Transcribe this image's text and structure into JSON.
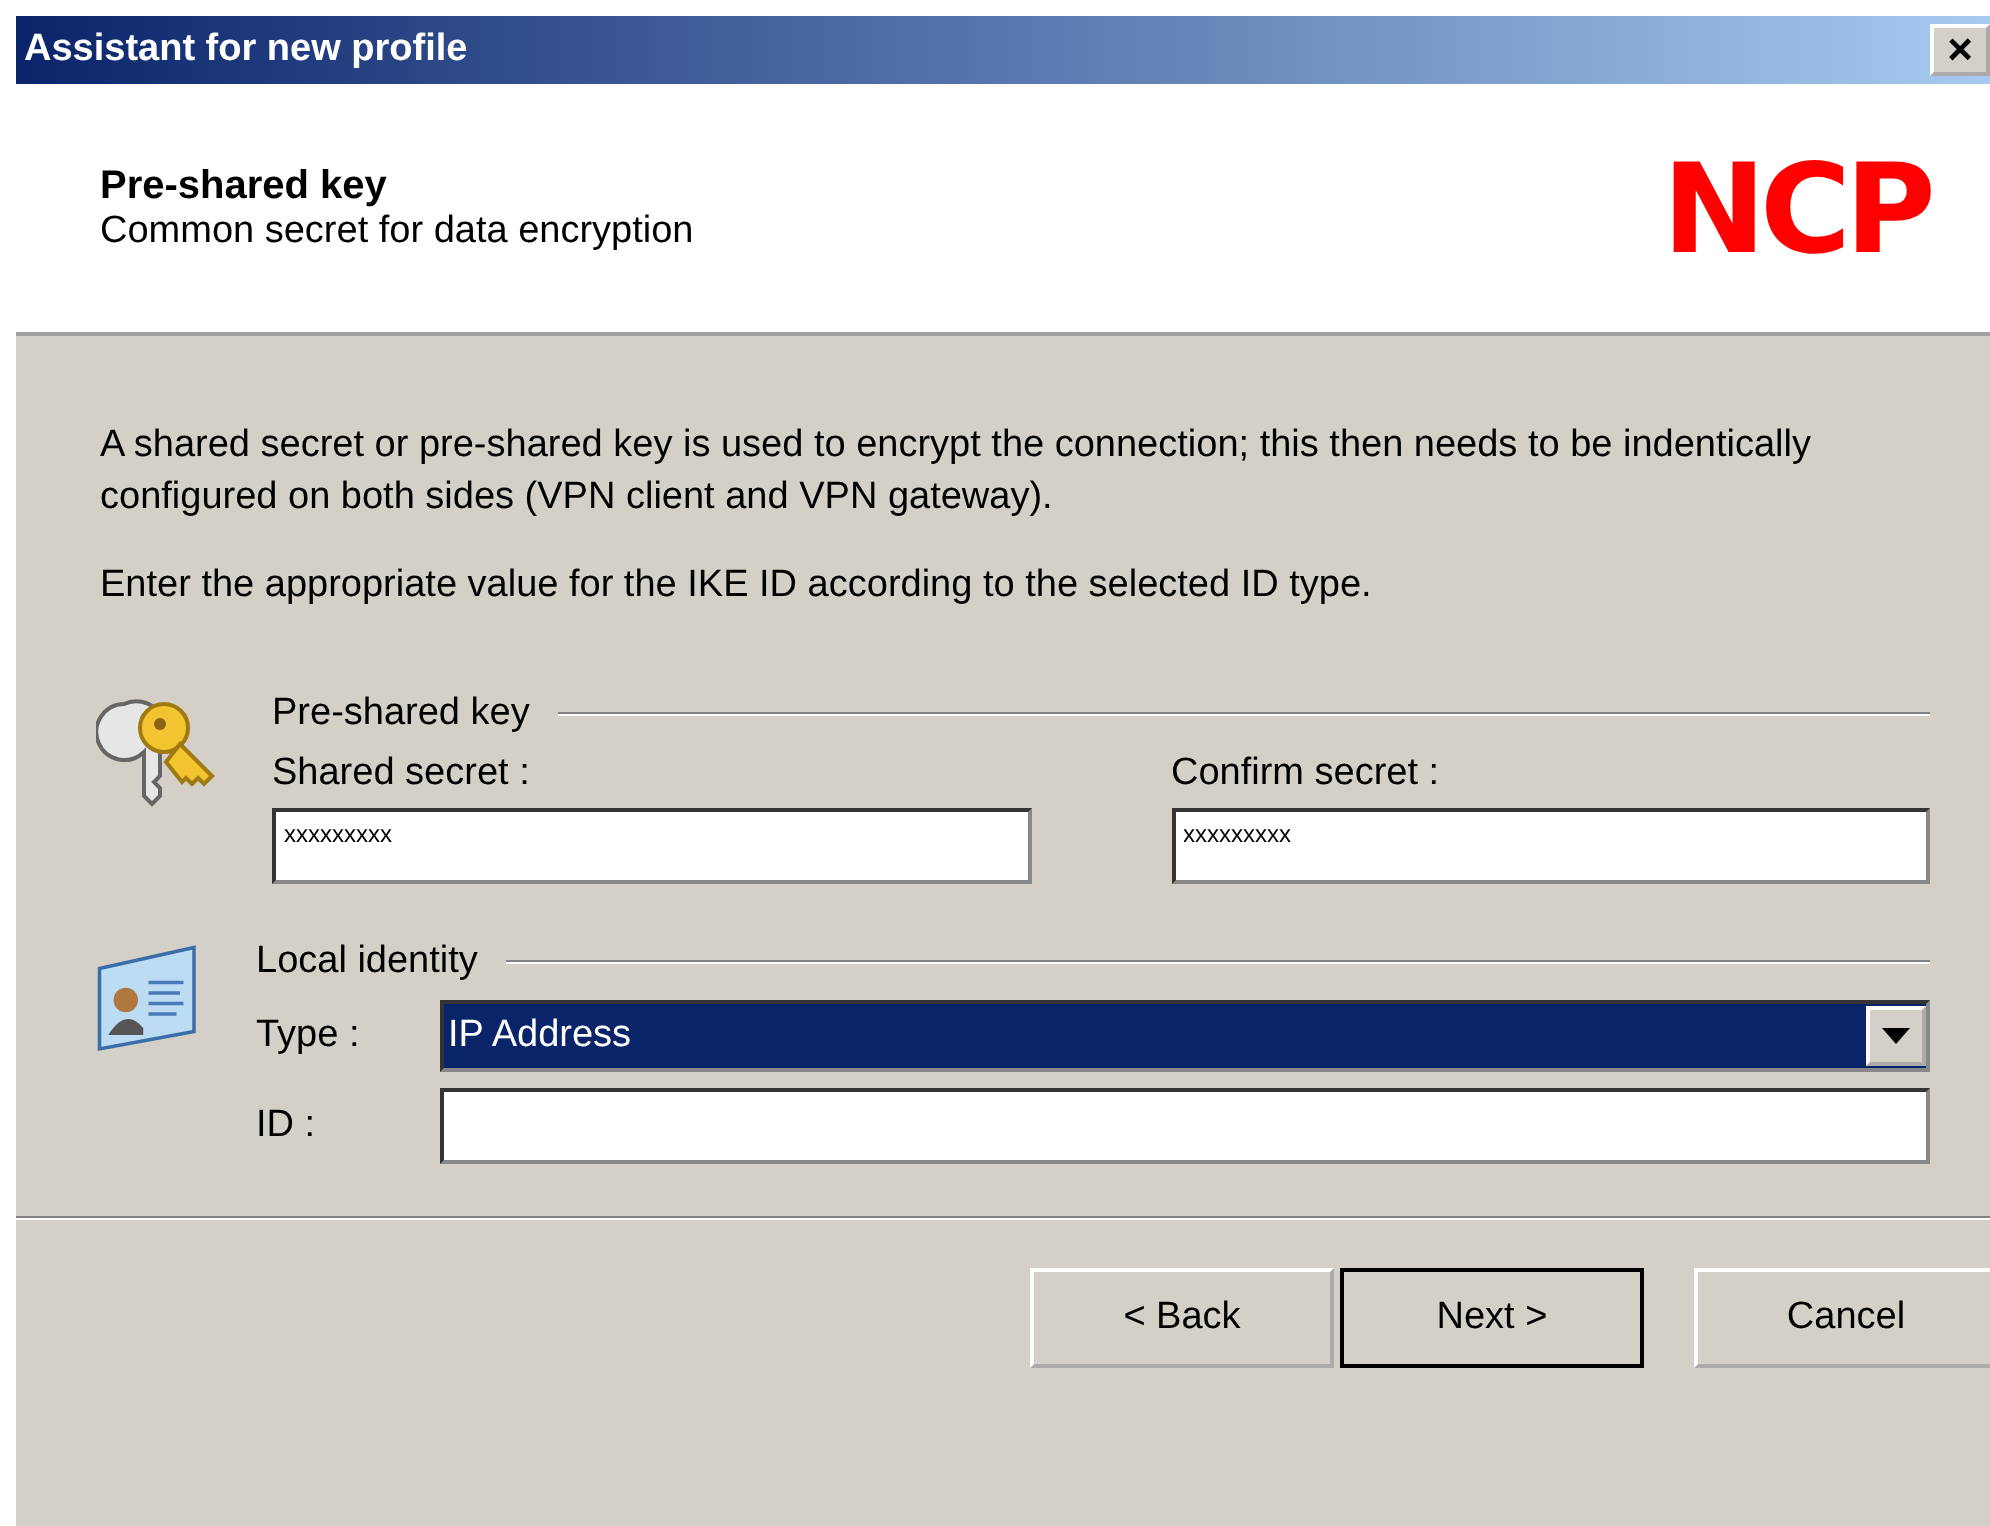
{
  "window": {
    "title": "Assistant for new profile",
    "close": "×"
  },
  "header": {
    "title": "Pre-shared key",
    "subtitle": "Common secret for data encryption",
    "logo": "NCP"
  },
  "paragraphs": [
    "A shared secret or pre-shared key is used to encrypt the connection; this then needs to be indentically configured on both sides (VPN client and VPN gateway).",
    "Enter the appropriate value for the IKE ID according to the selected ID type."
  ],
  "preshared_group": {
    "title": "Pre-shared key",
    "shared_secret": {
      "label": "Shared secret  :",
      "value": "xxxxxxxxx"
    },
    "confirm_secret": {
      "label": "Confirm secret :",
      "value": "xxxxxxxxx"
    }
  },
  "identity_group": {
    "title": "Local identity",
    "type": {
      "label": "Type :",
      "value": "IP Address"
    },
    "id": {
      "label": "ID :"
    }
  },
  "buttons": [
    {
      "label": "< Back",
      "default": false
    },
    {
      "label": "Next >",
      "default": true
    },
    {
      "label": "Cancel",
      "default": false
    }
  ]
}
